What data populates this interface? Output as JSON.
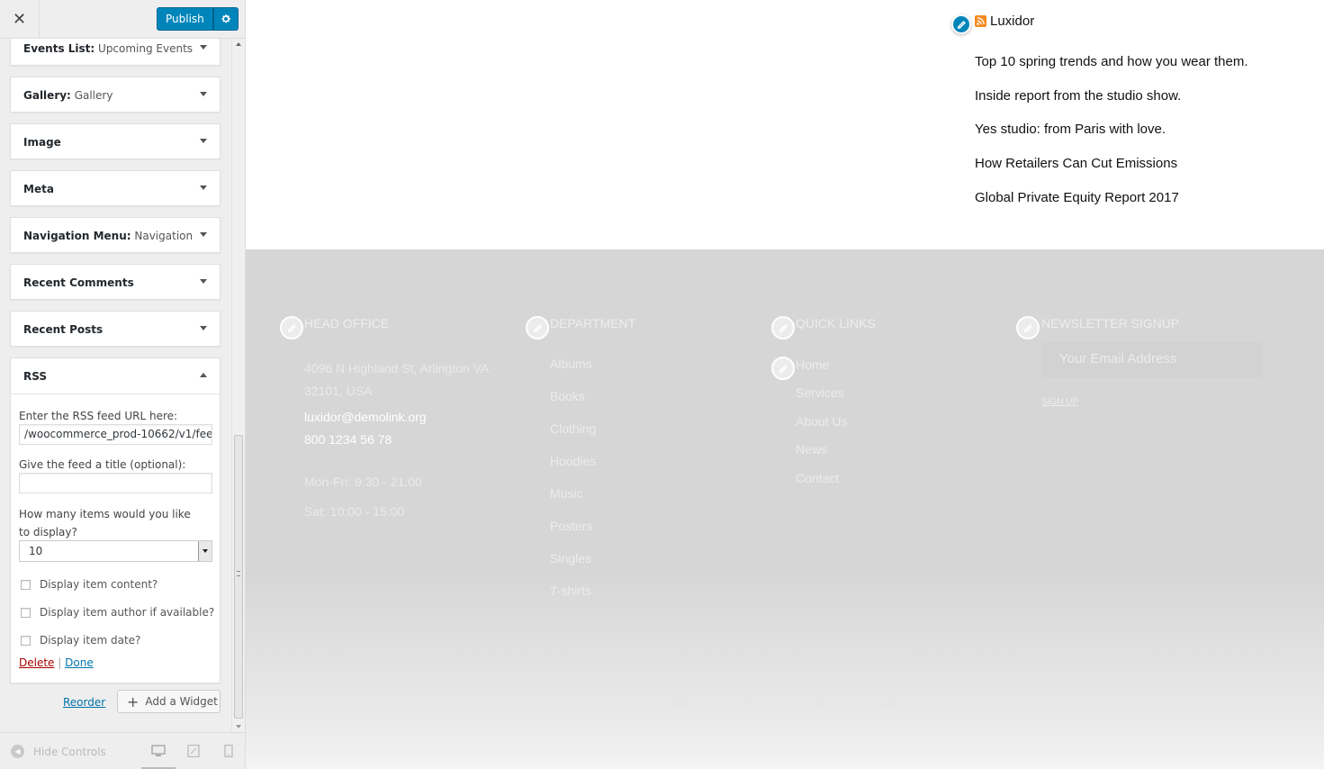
{
  "header": {
    "close_label": "✕",
    "publish_label": "Publish",
    "gear_icon": "gear-icon"
  },
  "widgets": [
    {
      "title": "Events List:",
      "subtitle": "Upcoming Events"
    },
    {
      "title": "Gallery:",
      "subtitle": "Gallery"
    },
    {
      "title": "Image",
      "subtitle": ""
    },
    {
      "title": "Meta",
      "subtitle": ""
    },
    {
      "title": "Navigation Menu:",
      "subtitle": "Navigation"
    },
    {
      "title": "Recent Comments",
      "subtitle": ""
    },
    {
      "title": "Recent Posts",
      "subtitle": ""
    }
  ],
  "rss_widget": {
    "title": "RSS",
    "url_label": "Enter the RSS feed URL here:",
    "url_value": "/woocommerce_prod-10662/v1/feed",
    "feed_title_label": "Give the feed a title (optional):",
    "feed_title_value": "",
    "items_label": "How many items would you like to display?",
    "items_value": "10",
    "check_content": "Display item content?",
    "check_author": "Display item author if available?",
    "check_date": "Display item date?",
    "delete_label": "Delete",
    "separator": "|",
    "done_label": "Done"
  },
  "sidebar_actions": {
    "reorder_label": "Reorder",
    "add_widget_label": "Add a Widget"
  },
  "sidebar_footer": {
    "hide_controls_label": "Hide Controls"
  },
  "preview": {
    "rss_title": "Luxidor",
    "rss_items": [
      "Top 10 spring trends and how you wear them.",
      "Inside report from the studio show.",
      "Yes studio: from Paris with love.",
      "How Retailers Can Cut Emissions",
      "Global Private Equity Report 2017"
    ],
    "footer": {
      "head_office": {
        "heading": "HEAD OFFICE",
        "address_line1": "4096 N Highland St, Arlington VA",
        "address_line2": "32101, USA",
        "email": "luxidor@demolink.org",
        "phone": "800 1234 56 78",
        "hours1": "Mon-Fri: 9:30 - 21:00",
        "hours2": "Sat: 10:00 - 15:00"
      },
      "department": {
        "heading": "DEPARTMENT",
        "links": [
          "Albums",
          "Books",
          "Clothing",
          "Hoodies",
          "Music",
          "Posters",
          "Singles",
          "T-shirts"
        ]
      },
      "quick_links": {
        "heading": "QUICK LINKS",
        "links": [
          "Home",
          "Services",
          "About Us",
          "News",
          "Contact"
        ]
      },
      "newsletter": {
        "heading": "NEWSLETTER SIGNUP",
        "placeholder": "Your Email Address",
        "signup_label": "SIGN UP"
      },
      "social_icons": [
        "linkedin-icon",
        "twitter-icon",
        "facebook-icon",
        "instagram-icon"
      ]
    }
  }
}
